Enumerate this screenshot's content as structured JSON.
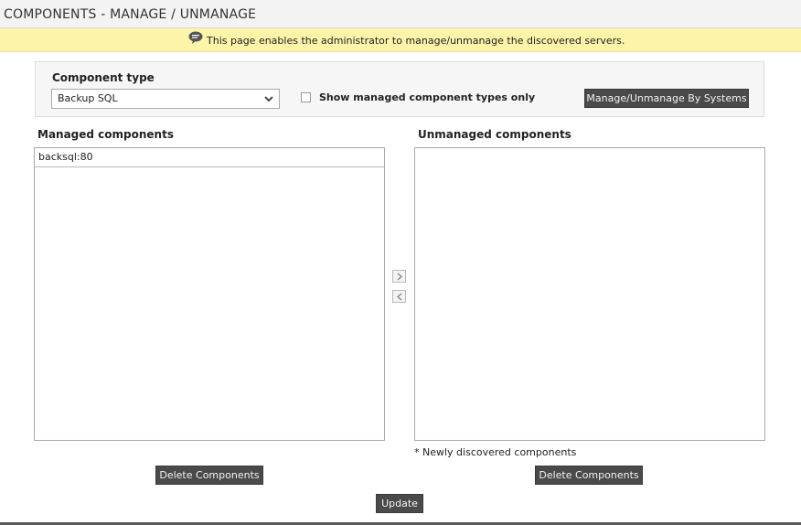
{
  "header": {
    "title": "COMPONENTS - MANAGE / UNMANAGE"
  },
  "info": {
    "icon": "speech-bubble-icon",
    "message": "This page enables the administrator to manage/unmanage the discovered servers."
  },
  "filters": {
    "component_type_label": "Component type",
    "component_type_value": "Backup SQL",
    "show_managed_only_label": "Show managed component types only",
    "show_managed_only_checked": false,
    "manage_by_systems_button": "Manage/Unmanage By Systems"
  },
  "managed": {
    "title": "Managed components",
    "items": [
      "backsql:80"
    ],
    "delete_button": "Delete Components"
  },
  "unmanaged": {
    "title": "Unmanaged components",
    "items": [],
    "note": "* Newly discovered components",
    "delete_button": "Delete Components"
  },
  "actions": {
    "update_button": "Update"
  },
  "colors": {
    "info_bar_bg": "#fdf4a9",
    "button_bg": "#4a4a4a",
    "title_bar_bg": "#f3f3f3"
  }
}
